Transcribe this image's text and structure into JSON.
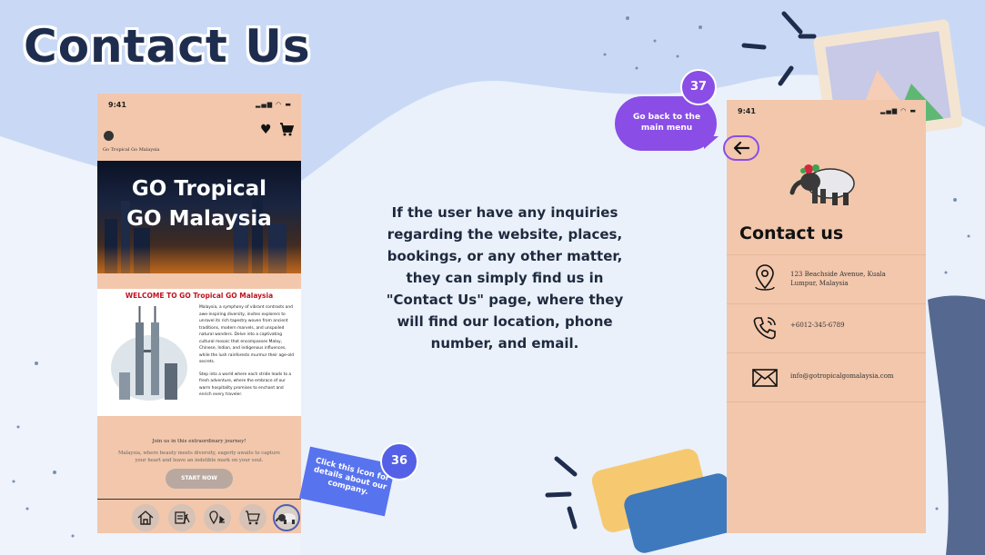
{
  "slide": {
    "title": "Contact Us",
    "description": "If the user have any inquiries regarding the website, places, bookings, or any other matter, they can simply find us in \"Contact Us\" page, where they will find our location, phone number, and email."
  },
  "phone_home": {
    "time": "9:41",
    "brand": "Go Tropical Go Malaysia",
    "hero_line1": "GO Tropical",
    "hero_line2": "GO Malaysia",
    "welcome_title": "WELCOME TO GO Tropical GO Malaysia",
    "welcome_p1": "Malaysia, a symphony of vibrant contrasts and awe-inspiring diversity, invites explorers to unravel its rich tapestry woven from ancient traditions, modern marvels, and unspoiled natural wonders. Delve into a captivating cultural mosaic that encompasses Malay, Chinese, Indian, and indigenous influences, while the lush rainforests murmur their age-old secrets.",
    "welcome_p2": "Step into a world where each stride leads to a fresh adventure, where the embrace of our warm hospitality promises to enchant and enrich every traveler.",
    "join_title": "Join us in this extraordinary journey!",
    "join_desc": "Malaysia, where beauty meets diversity, eagerly awaits to capture your heart and leave an indelible mark on your soul.",
    "start_button": "START NOW",
    "nav_icons": [
      "home-icon",
      "booking-icon",
      "places-icon",
      "cart-icon",
      "tapir-icon"
    ]
  },
  "callout_36": {
    "number": "36",
    "text": "Click this icon for details about our company."
  },
  "callout_37": {
    "number": "37",
    "text": "Go back to the main menu"
  },
  "phone_contact": {
    "time": "9:41",
    "heading": "Contact us",
    "address_line1": "123 Beachside Avenue, Kuala",
    "address_line2": "Lumpur, Malaysia",
    "phone": "+6012-345-6789",
    "email": "info@gotropicalgomalaysia.com"
  },
  "colors": {
    "phone_bg": "#f2c7ac",
    "title": "#1e2d4d",
    "callout_blue": "#5873ee",
    "callout_purple": "#8a4de6",
    "welcome_red": "#c0121c"
  }
}
